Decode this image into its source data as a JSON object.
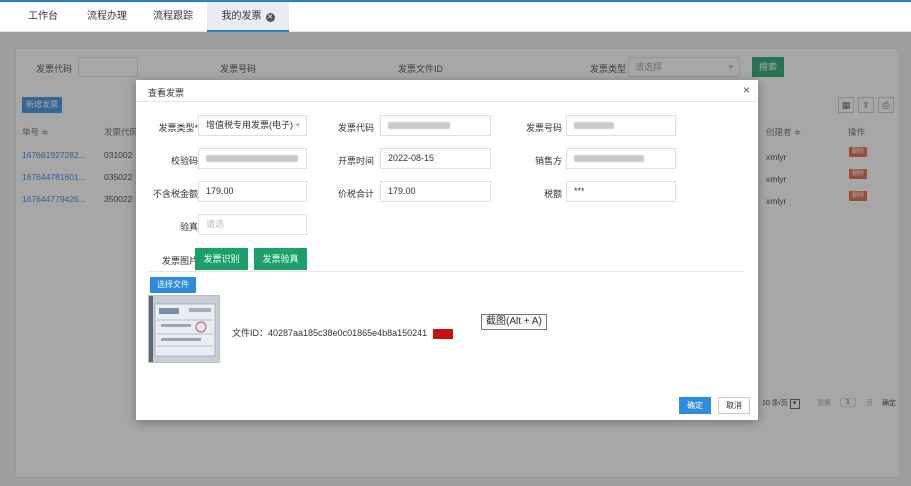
{
  "tabs": [
    {
      "label": "工作台"
    },
    {
      "label": "流程办理"
    },
    {
      "label": "流程跟踪"
    },
    {
      "label": "我的发票",
      "close": "✕"
    }
  ],
  "search": {
    "code_label": "发票代码",
    "number_label": "发票号码",
    "file_id_label": "发票文件ID",
    "type_label": "发票类型",
    "type_placeholder": "请选择",
    "search_button": "搜索"
  },
  "toolbar": {
    "add_button": "新增发票"
  },
  "table": {
    "columns": [
      "单号 ≑",
      "发票代码",
      "创建者 ≑",
      "操作"
    ],
    "rows": [
      {
        "id": "167661927282...",
        "code": "031002",
        "creator": "xmlyr",
        "action": "删除"
      },
      {
        "id": "167644781601...",
        "code": "035022",
        "creator": "xmlyr",
        "action": "删除"
      },
      {
        "id": "167644779426...",
        "code": "350022",
        "creator": "xmlyr",
        "action": "删除"
      }
    ]
  },
  "pager": {
    "per_page": "10 条/页",
    "goto": "到第",
    "page": "1",
    "page_unit": "页",
    "confirm": "确定"
  },
  "modal": {
    "title": "查看发票",
    "close": "×",
    "fields": {
      "type_label": "发票类型*",
      "type_value": "增值税专用发票(电子)",
      "code_label": "发票代码",
      "number_label": "发票号码",
      "check_label": "校验码",
      "date_label": "开票时间",
      "date_value": "2022-08-15",
      "seller_label": "销售方",
      "amount_label": "不含税金额",
      "amount_value": "179.00",
      "total_label": "价税合计",
      "total_value": "179.00",
      "tax_label": "税额",
      "tax_value": "***",
      "verify_label": "验真",
      "verify_placeholder": "请选",
      "image_label": "发票图片"
    },
    "tabs": [
      "发票识别",
      "发票验真"
    ],
    "choose_file": "选择文件",
    "file_id_text": "文件ID：40287aa185c38e0c01865e4b8a150241",
    "delete_badge": "删除",
    "ok_button": "确定",
    "cancel_button": "取消"
  },
  "tooltip": "截图(Alt + A)"
}
